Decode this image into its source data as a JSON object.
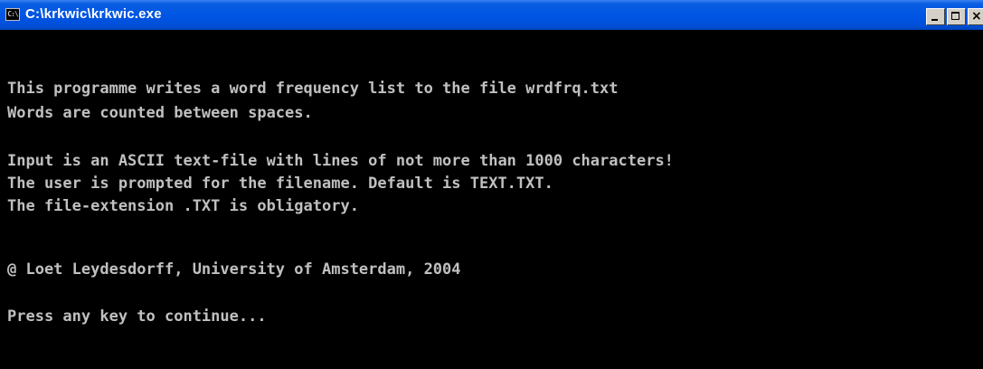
{
  "window": {
    "title": "C:\\krkwic\\krkwic.exe",
    "icon_label": "C:\\",
    "controls": [
      "minimize",
      "maximize",
      "close"
    ]
  },
  "console": {
    "lines": [
      "This programme writes a word frequency list to the file wrdfrq.txt",
      "Words are counted between spaces.",
      "Input is an ASCII text-file with lines of not more than 1000 characters!",
      "The user is prompted for the filename. Default is TEXT.TXT.",
      "The file-extension .TXT is obligatory.",
      "@ Loet Leydesdorff, University of Amsterdam, 2004",
      "Press any key to continue..."
    ]
  },
  "colors": {
    "titlebar": "#0055e5",
    "console_bg": "#000000",
    "console_text": "#c0c0c0"
  }
}
